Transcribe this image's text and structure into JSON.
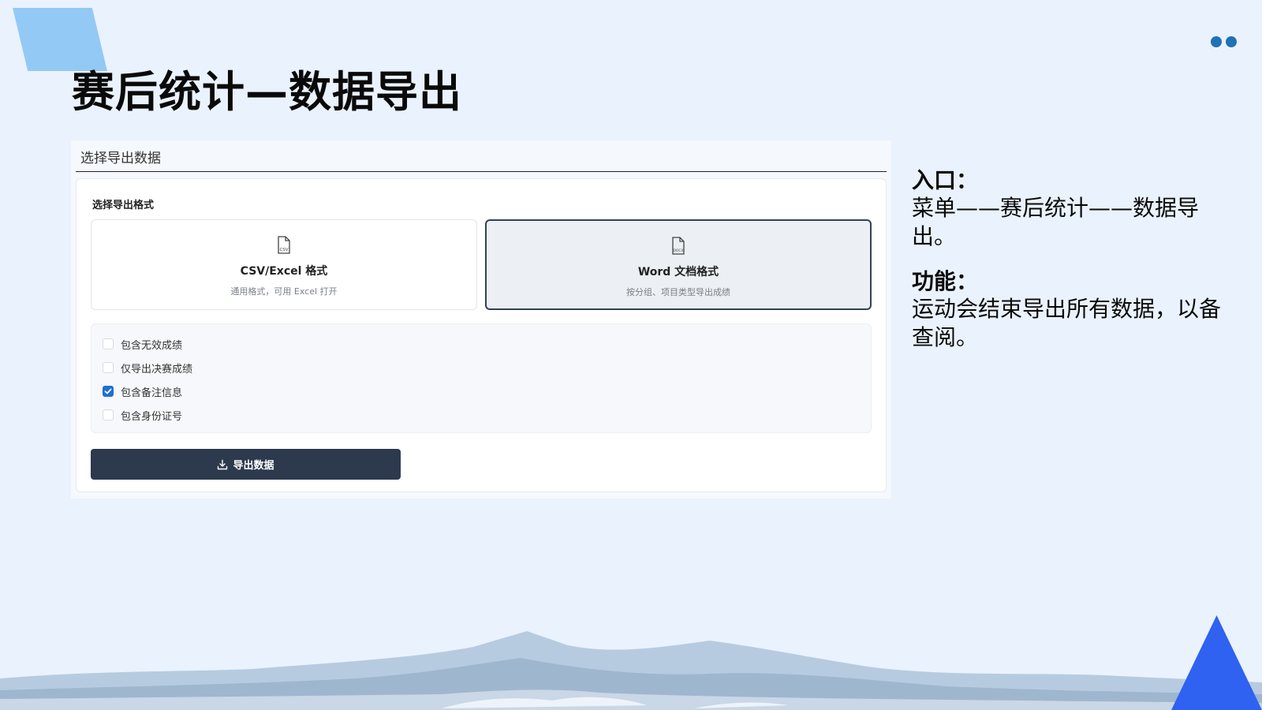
{
  "slide": {
    "title": "赛后统计—数据导出"
  },
  "panel": {
    "header": "选择导出数据",
    "format_label": "选择导出格式",
    "formats": [
      {
        "icon": "csv-file-icon",
        "icon_text": "CSV",
        "title": "CSV/Excel 格式",
        "desc": "通用格式，可用 Excel 打开",
        "selected": false
      },
      {
        "icon": "docx-file-icon",
        "icon_text": "DOCX",
        "title": "Word 文档格式",
        "desc": "按分组、项目类型导出成绩",
        "selected": true
      }
    ],
    "options": [
      {
        "label": "包含无效成绩",
        "checked": false
      },
      {
        "label": "仅导出决赛成绩",
        "checked": false
      },
      {
        "label": "包含备注信息",
        "checked": true
      },
      {
        "label": "包含身份证号",
        "checked": false
      }
    ],
    "export_button": {
      "label": "导出数据",
      "icon": "download-icon"
    }
  },
  "side": {
    "entry_heading": "入口：",
    "entry_text": "菜单——赛后统计——数据导出。",
    "function_heading": "功能：",
    "function_text": "运动会结束导出所有数据，以备查阅。"
  },
  "colors": {
    "background": "#eaf2fd",
    "button": "#2d3a4d",
    "checkbox_checked": "#1f6fd1",
    "triangle": "#2f62f0",
    "deco": "#93c9f5",
    "dots": "#1f72b5"
  }
}
